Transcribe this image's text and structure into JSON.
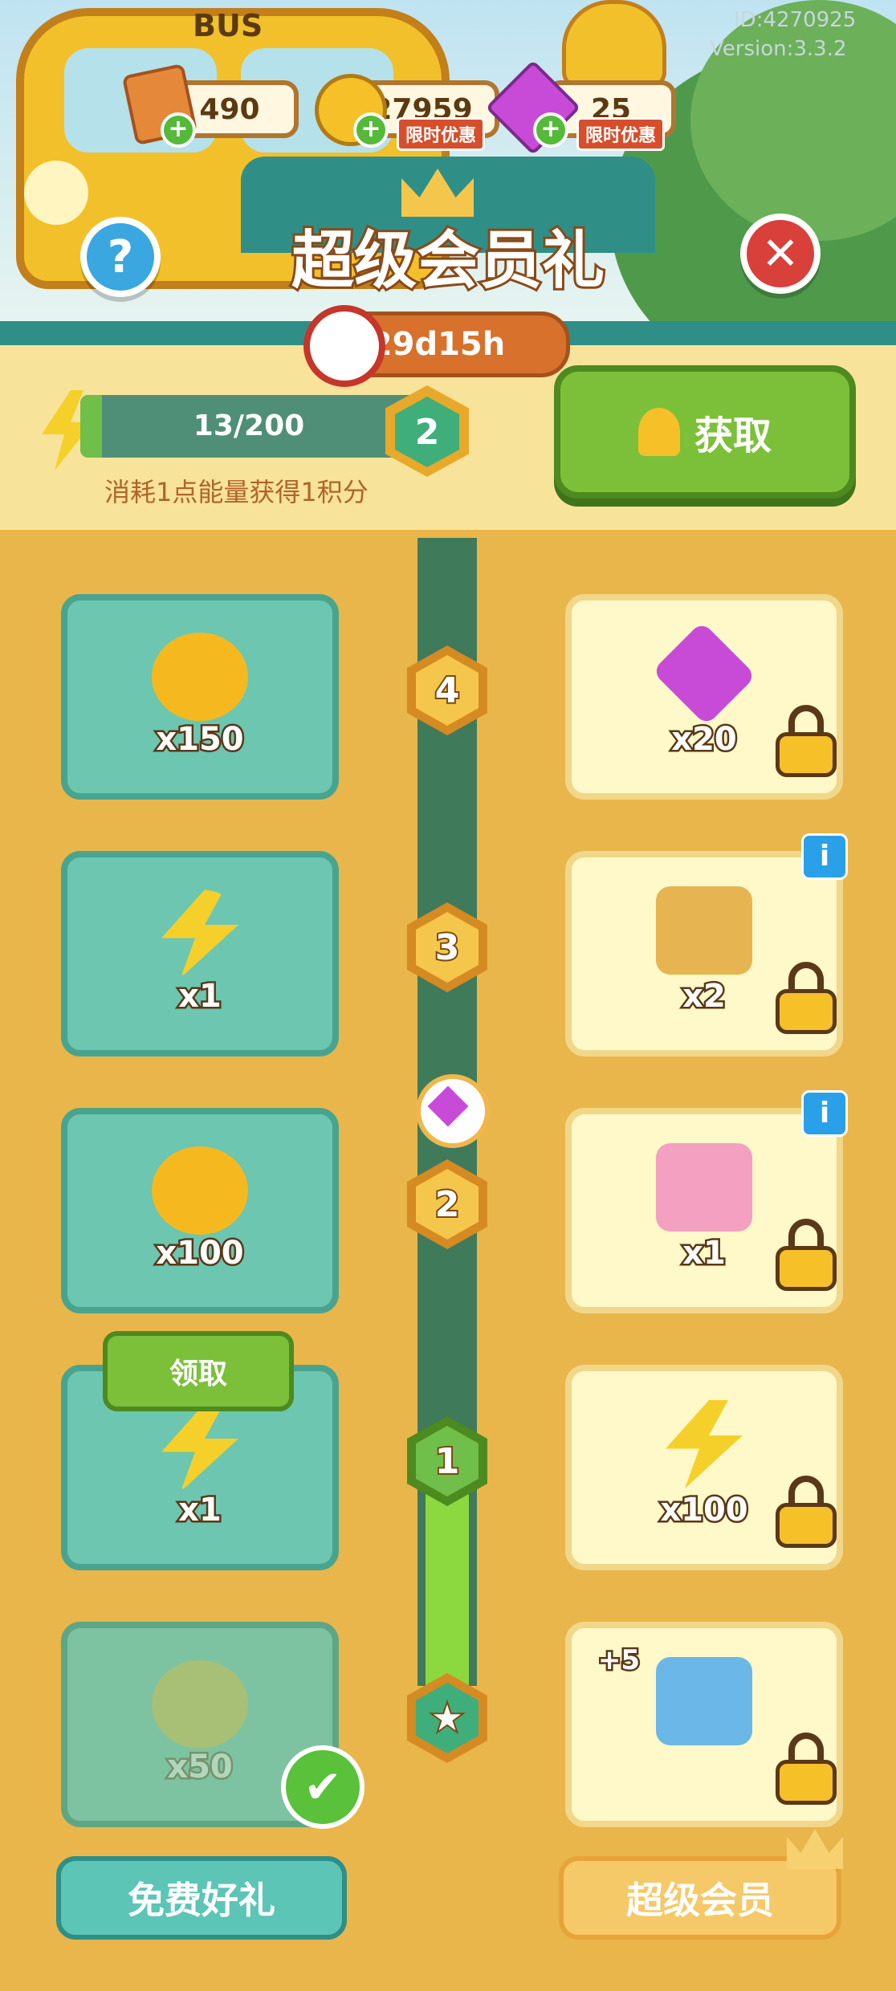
{
  "header": {
    "bus_label": "BUS",
    "id_text": "ID:4270925",
    "version_text": "Version:3.3.2",
    "currencies": [
      {
        "icon": "ticket-icon",
        "value": "490",
        "tag": ""
      },
      {
        "icon": "coin-icon",
        "value": "27959",
        "tag": "限时优惠"
      },
      {
        "icon": "gem-icon",
        "value": "25",
        "tag": "限时优惠"
      }
    ],
    "help_label": "?",
    "close_label": "✕",
    "title": "超级会员礼",
    "timer": "29d15h"
  },
  "progress": {
    "value": 13,
    "max": 200,
    "text": "13/200",
    "level": "2",
    "note": "消耗1点能量获得1积分",
    "get_label": "获取"
  },
  "rewards": {
    "rows": [
      {
        "level": "4",
        "free": {
          "item": "coins-icon",
          "amount": "x150"
        },
        "vip": {
          "item": "gems-icon",
          "amount": "x20",
          "info": false
        }
      },
      {
        "level": "3",
        "free": {
          "item": "energy-icon",
          "amount": "x1"
        },
        "vip": {
          "item": "card-pack-icon",
          "amount": "x2",
          "info": true
        }
      },
      {
        "level": "2",
        "free": {
          "item": "coins-icon",
          "amount": "x100"
        },
        "vip": {
          "item": "fridge-skin-icon",
          "amount": "x1",
          "info": true
        }
      },
      {
        "level": "1",
        "free": {
          "item": "energy-icon",
          "amount": "x1"
        },
        "vip": {
          "item": "energy-bundle-icon",
          "amount": "x100",
          "info": false
        }
      },
      {
        "level": "★",
        "free": {
          "item": "coins-icon",
          "amount": "x50"
        },
        "vip": {
          "item": "gift-box-icon",
          "amount": "+5",
          "info": false
        }
      }
    ],
    "claim_label": "领取",
    "check_label": "✔"
  },
  "footer": {
    "free_tab": "免费好礼",
    "vip_tab": "超级会员"
  },
  "colors": {
    "background": "#e9b64c",
    "teal": "#2f8f87",
    "green_button": "#7cc03a",
    "vip_card": "#fff8c8",
    "free_card": "#6cc6b0"
  }
}
